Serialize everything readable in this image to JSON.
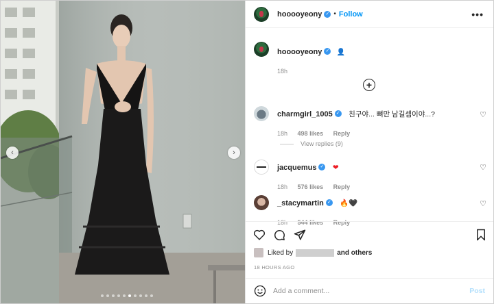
{
  "post": {
    "username": "hooooyeony",
    "verified_mark": "✓",
    "separator": "•",
    "follow_label": "Follow",
    "more_label": "•••",
    "caption_emoji": "👤",
    "caption_time": "18h"
  },
  "comments": [
    {
      "username": "charmgirl_1005",
      "text": "친구야... 뼈만 남길셈이야...?",
      "time": "18h",
      "likes": "498 likes",
      "reply_label": "Reply",
      "view_replies": "View replies (9)"
    },
    {
      "username": "jacquemus",
      "text": "❤",
      "time": "18h",
      "likes": "576 likes",
      "reply_label": "Reply"
    },
    {
      "username": "_stacymartin",
      "text": "🔥🖤",
      "time": "18h",
      "likes": "544 likes",
      "reply_label": "Reply"
    }
  ],
  "likes_line": {
    "prefix": "Liked by",
    "suffix": "and others"
  },
  "timestamp": "18 HOURS AGO",
  "add_comment": {
    "placeholder": "Add a comment...",
    "post_label": "Post"
  },
  "carousel": {
    "prev_glyph": "‹",
    "next_glyph": "›",
    "slide_count": 10,
    "active_slide": 5
  },
  "icons": {
    "like": "heart-icon",
    "comment": "comment-icon",
    "share": "share-icon",
    "save": "bookmark-icon",
    "emoji": "emoji-icon",
    "add": "plus-circle-icon"
  },
  "colors": {
    "accent": "#0095f6",
    "verified": "#3897f0",
    "heart_red": "#ed1c24",
    "post_disabled": "#b2dffc"
  }
}
